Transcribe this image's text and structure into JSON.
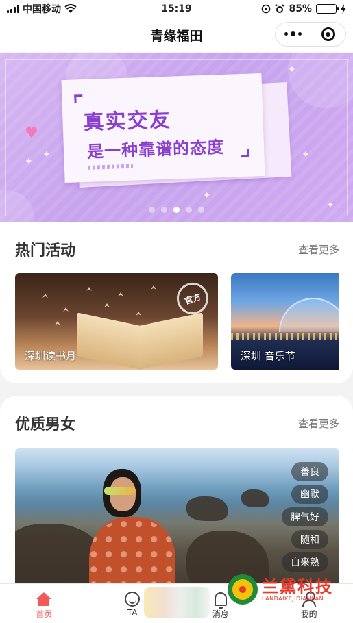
{
  "status_bar": {
    "carrier": "中国移动",
    "time": "15:19",
    "battery_percent": "85%",
    "battery_level": 0.85
  },
  "nav": {
    "title": "青缘福田"
  },
  "banner": {
    "line1": "真实交友",
    "line2": "是一种靠谱的态度",
    "slide_count": 5,
    "active_slide": 3
  },
  "hot_activities": {
    "title": "热门活动",
    "more_label": "查看更多",
    "items": [
      {
        "label": "深圳读书月",
        "stamp": "官方"
      },
      {
        "label": "深圳 音乐节"
      }
    ]
  },
  "quality_people": {
    "title": "优质男女",
    "more_label": "查看更多",
    "tags": [
      "善良",
      "幽默",
      "脾气好",
      "随和",
      "自来熟"
    ]
  },
  "tabbar": {
    "items": [
      {
        "label": "首页",
        "icon": "home-icon",
        "active": true
      },
      {
        "label": "TA",
        "icon": "smile-icon",
        "active": false
      },
      {
        "label": "消息",
        "icon": "bell-icon",
        "active": false
      },
      {
        "label": "我的",
        "icon": "user-icon",
        "active": false
      }
    ]
  },
  "watermark": {
    "cn": "兰黛科技",
    "en": "LANDAIKEJIDIANJIAN"
  },
  "colors": {
    "accent": "#f25a5a",
    "banner_purple": "#c7a3ee",
    "banner_text": "#8a3fd0",
    "battery_green": "#3ccb3a"
  }
}
